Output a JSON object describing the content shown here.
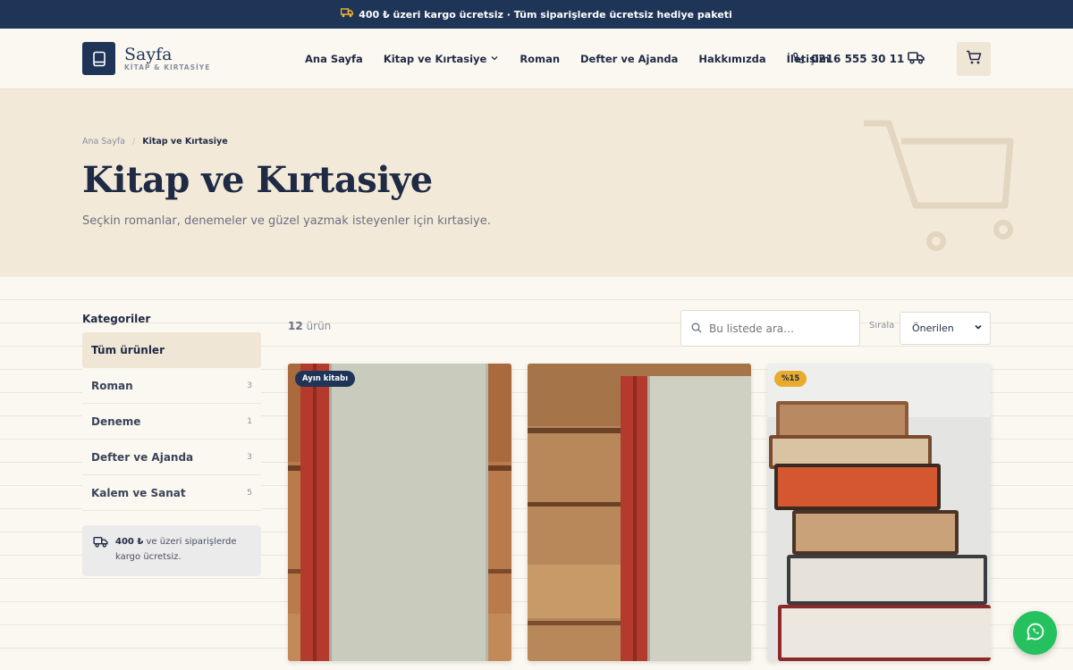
{
  "announcement": {
    "text": "400 ₺ üzeri kargo ücretsiz · Tüm siparişlerde ücretsiz hediye paketi"
  },
  "brand": {
    "name": "Sayfa",
    "tagline": "KİTAP & KIRTASİYE"
  },
  "nav": {
    "items": [
      {
        "label": "Ana Sayfa"
      },
      {
        "label": "Kitap ve Kırtasiye"
      },
      {
        "label": "Roman"
      },
      {
        "label": "Defter ve Ajanda"
      },
      {
        "label": "Hakkımızda"
      },
      {
        "label": "İletişim"
      }
    ],
    "phone": "0216 555 30 11"
  },
  "hero": {
    "breadcrumb": [
      "Ana Sayfa",
      "Kitap ve Kırtasiye"
    ],
    "title": "Kitap ve Kırtasiye",
    "subtitle": "Seçkin romanlar, denemeler ve güzel yazmak isteyenler için kırtasiye."
  },
  "sidebar": {
    "title": "Kategoriler",
    "categories": [
      {
        "label": "Tüm ürünler",
        "count": ""
      },
      {
        "label": "Roman",
        "count": "3"
      },
      {
        "label": "Deneme",
        "count": "1"
      },
      {
        "label": "Defter ve Ajanda",
        "count": "3"
      },
      {
        "label": "Kalem ve Sanat",
        "count": "5"
      }
    ],
    "shipping_strong": "400 ₺",
    "shipping_text": " ve üzeri siparişlerde kargo ücretsiz."
  },
  "listing": {
    "count": "12",
    "count_suffix": "ürün",
    "search_placeholder": "Bu listede ara…",
    "sort_label": "Sırala",
    "sort_value": "Önerilen"
  },
  "products": [
    {
      "badge": "Ayın kitabı"
    },
    {
      "badge": ""
    },
    {
      "badge": "%15"
    }
  ],
  "colors": {
    "navy": "#1f3557",
    "cream": "#fbf8f1",
    "beige": "#f2e9d8",
    "gold": "#e8ab2c",
    "whatsapp": "#25c15e"
  },
  "icons": [
    "truck-icon",
    "book-icon",
    "chevron-down-icon",
    "phone-icon",
    "cart-icon",
    "search-icon",
    "whatsapp-icon"
  ]
}
